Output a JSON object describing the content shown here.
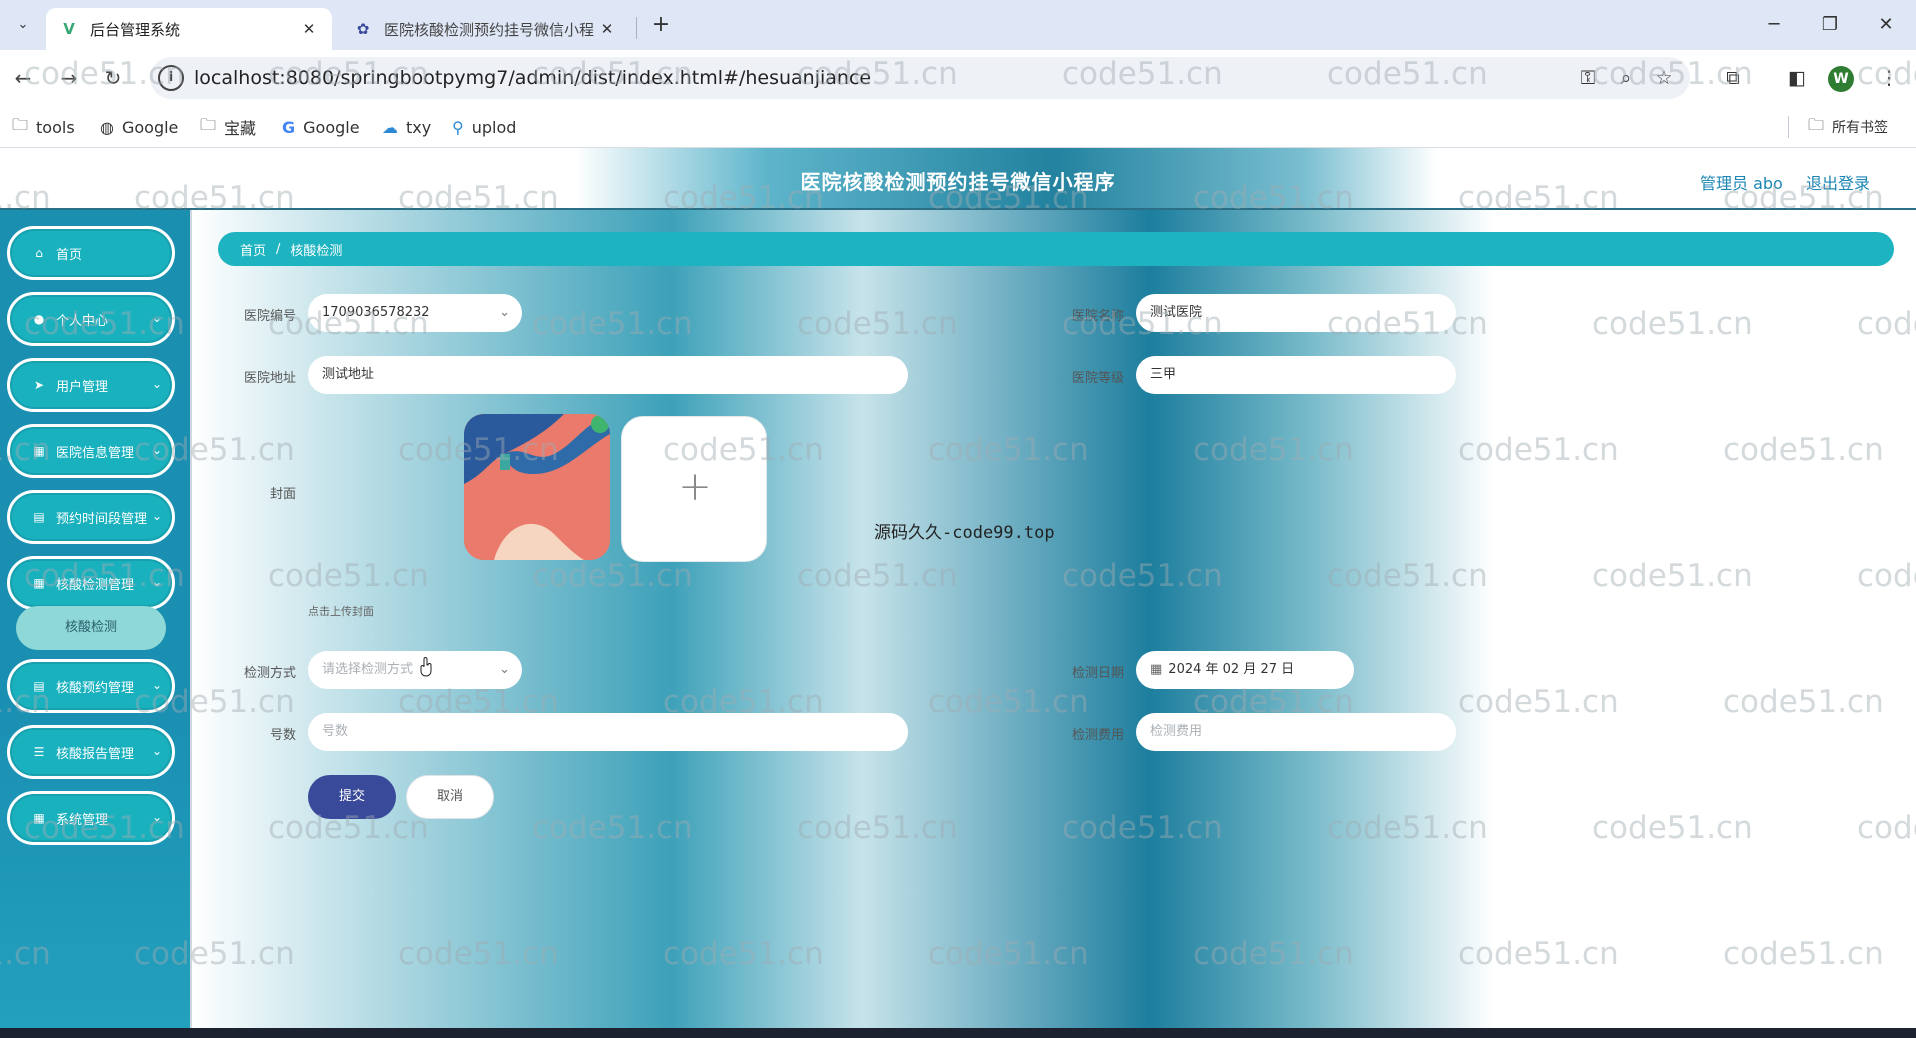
{
  "browser": {
    "tabs": [
      {
        "title": "后台管理系统",
        "active": true
      },
      {
        "title": "医院核酸检测预约挂号微信小程",
        "active": false
      }
    ],
    "url": "localhost:8080/springbootpymg7/admin/dist/index.html#/hesuanjiance",
    "bookmarks": [
      "tools",
      "Google",
      "宝藏",
      "Google",
      "txy",
      "uplod"
    ],
    "all_bookmarks": "所有书签",
    "profile_initial": "W"
  },
  "header": {
    "title": "医院核酸检测预约挂号微信小程序",
    "admin_label": "管理员 abo",
    "logout_label": "退出登录"
  },
  "sidebar": {
    "items": [
      {
        "label": "首页",
        "icon": "home-icon"
      },
      {
        "label": "个人中心",
        "icon": "user-icon"
      },
      {
        "label": "用户管理",
        "icon": "send-icon"
      },
      {
        "label": "医院信息管理",
        "icon": "grid-icon"
      },
      {
        "label": "预约时间段管理",
        "icon": "doc-icon"
      },
      {
        "label": "核酸检测管理",
        "icon": "grid-icon"
      },
      {
        "label": "核酸预约管理",
        "icon": "doc-icon"
      },
      {
        "label": "核酸报告管理",
        "icon": "sliders-icon"
      },
      {
        "label": "系统管理",
        "icon": "grid-icon"
      }
    ],
    "sub_active": "核酸检测"
  },
  "breadcrumb": {
    "home": "首页",
    "current": "核酸检测"
  },
  "form": {
    "hospital_no_label": "医院编号",
    "hospital_no_value": "1709036578232",
    "hospital_name_label": "医院名称",
    "hospital_name_value": "测试医院",
    "address_label": "医院地址",
    "address_value": "测试地址",
    "level_label": "医院等级",
    "level_value": "三甲",
    "cover_label": "封面",
    "cover_hint": "点击上传封面",
    "method_label": "检测方式",
    "method_placeholder": "请选择检测方式",
    "date_label": "检测日期",
    "date_value": "2024 年 02 月 27 日",
    "number_label": "号数",
    "number_placeholder": "号数",
    "fee_label": "检测费用",
    "fee_placeholder": "检测费用",
    "submit_label": "提交",
    "cancel_label": "取消"
  },
  "source_mark": "源码久久-code99.top",
  "watermark": "code51.cn",
  "colors": {
    "accent": "#1db3c0",
    "submit": "#3a4a9a",
    "sidebar": "#1b8fb0"
  }
}
